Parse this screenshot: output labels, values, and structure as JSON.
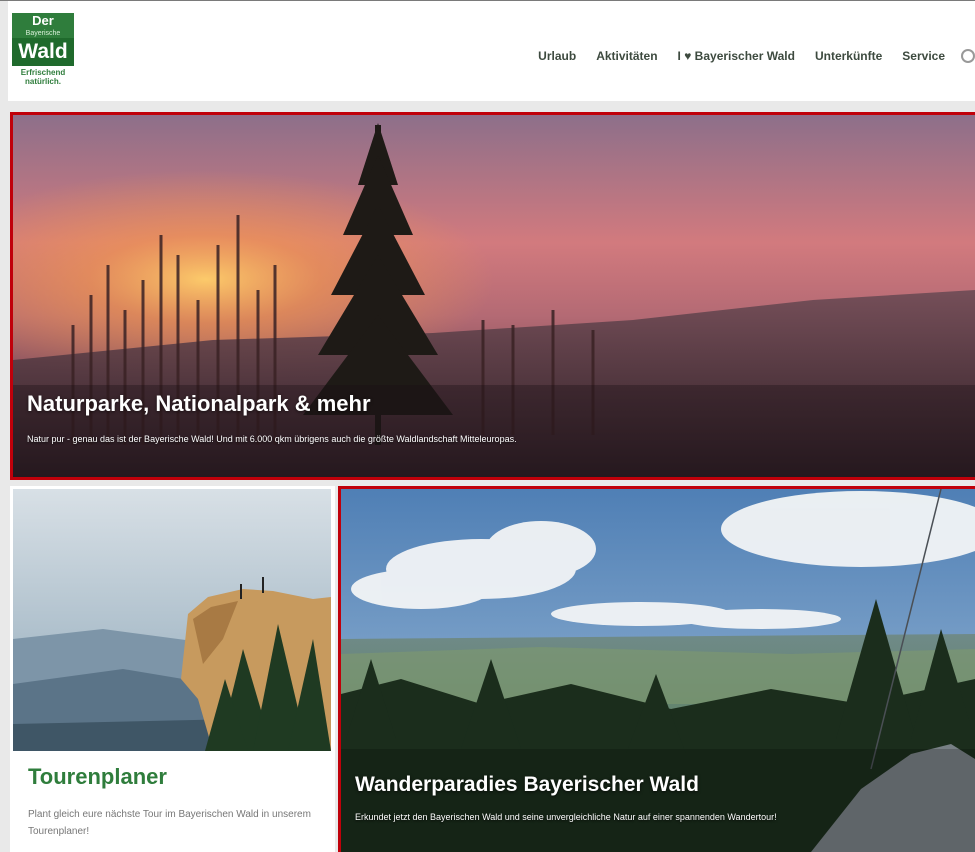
{
  "logo": {
    "line1": "Der",
    "line2": "Bayerische",
    "line3": "Wald",
    "tagline": "Erfrischend natürlich."
  },
  "nav": {
    "items": [
      "Urlaub",
      "Aktivitäten",
      "I ♥ Bayerischer Wald",
      "Unterkünfte",
      "Service"
    ]
  },
  "hero": {
    "title": "Naturparke, Nationalpark & mehr",
    "subtitle": "Natur pur - genau das ist der Bayerische Wald! Und mit 6.000 qkm übrigens auch die größte Waldlandschaft Mitteleuropas."
  },
  "tour_card": {
    "title": "Tourenplaner",
    "description": "Plant gleich eure nächste Tour im Bayerischen Wald in unserem Tourenplaner!"
  },
  "feature": {
    "title": "Wanderparadies Bayerischer Wald",
    "subtitle": "Erkundet jetzt den Bayerischen Wald und seine unvergleichliche Natur auf einer spannenden Wandertour!"
  },
  "colors": {
    "brand_green": "#2f7d3c",
    "highlight_border": "#c0000a"
  }
}
